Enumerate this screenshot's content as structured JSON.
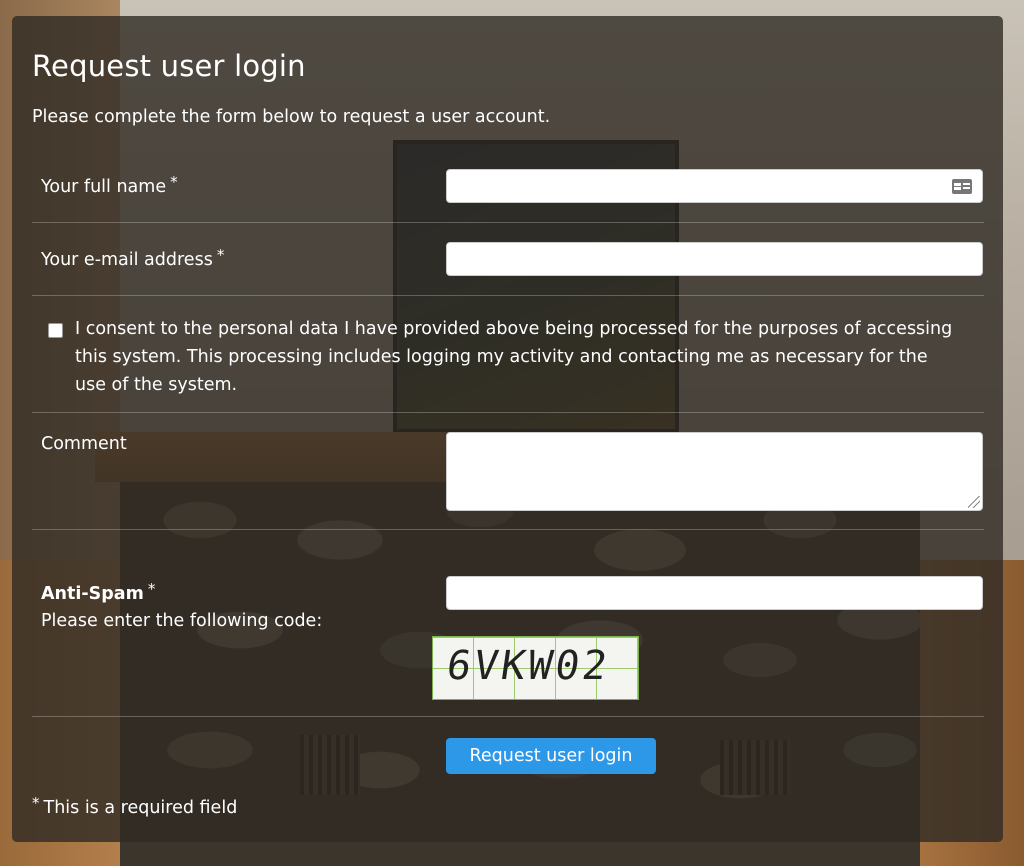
{
  "form": {
    "title": "Request user login",
    "intro": "Please complete the form below to request a user account.",
    "required_marker": "*",
    "full_name": {
      "label": "Your full name",
      "value": "",
      "icon": "contact-card-icon"
    },
    "email": {
      "label": "Your e-mail address",
      "value": ""
    },
    "consent": {
      "checked": false,
      "text": "I consent to the personal data I have provided above being processed for the purposes of accessing this system. This processing includes logging my activity and contacting me as necessary for the use of the system."
    },
    "comment": {
      "label": "Comment",
      "value": ""
    },
    "antispam": {
      "label": "Anti-Spam",
      "instruction": "Please enter the following code:",
      "value": "",
      "captcha_code": "6VKW02"
    },
    "submit_label": "Request user login",
    "footnote": "This is a required field"
  },
  "colors": {
    "panel_bg": "rgba(48,42,36,0.80)",
    "submit_bg": "#2d97e8",
    "text": "#ffffff"
  }
}
